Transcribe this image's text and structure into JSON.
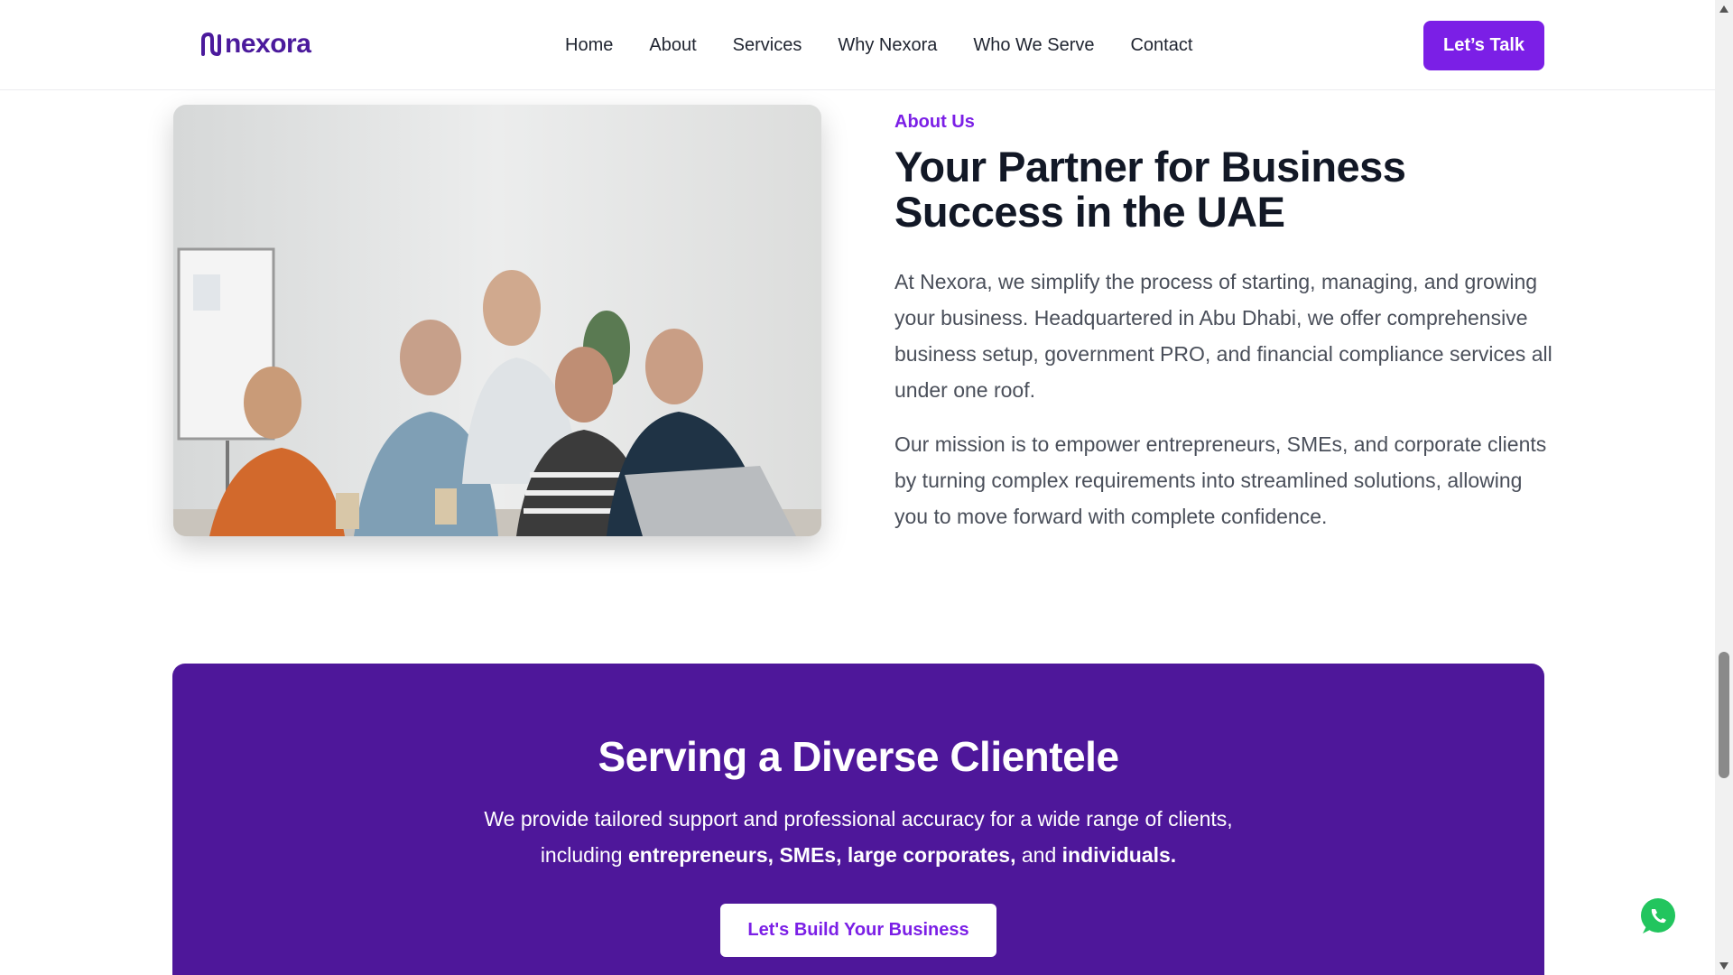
{
  "header": {
    "logo_text": "nexora",
    "nav": [
      "Home",
      "About",
      "Services",
      "Why Nexora",
      "Who We Serve",
      "Contact"
    ],
    "cta_label": "Let’s Talk",
    "brand_color": "#4b1a9c",
    "accent_color": "#7b1fe6"
  },
  "about": {
    "label": "About Us",
    "title": "Your Partner for Business Success in the UAE",
    "paragraph1": "At Nexora, we simplify the process of starting, managing, and growing your business. Headquartered in Abu Dhabi, we offer comprehensive business setup, government PRO, and financial compliance services all under one roof.",
    "paragraph2": "Our mission is to empower entrepreneurs, SMEs, and corporate clients by turning complex requirements into streamlined solutions, allowing you to move forward with complete confidence."
  },
  "clientele": {
    "title": "Serving a Diverse Clientele",
    "text_prefix": "We provide tailored support and professional accuracy for a wide range of clients, including ",
    "bold1": "entrepreneurs, SMEs, large corporates,",
    "text_mid": " and ",
    "bold2": "individuals.",
    "button_label": "Let's Build Your Business",
    "background_color": "#4e179a"
  },
  "floating": {
    "whatsapp_icon": "whatsapp-icon"
  }
}
